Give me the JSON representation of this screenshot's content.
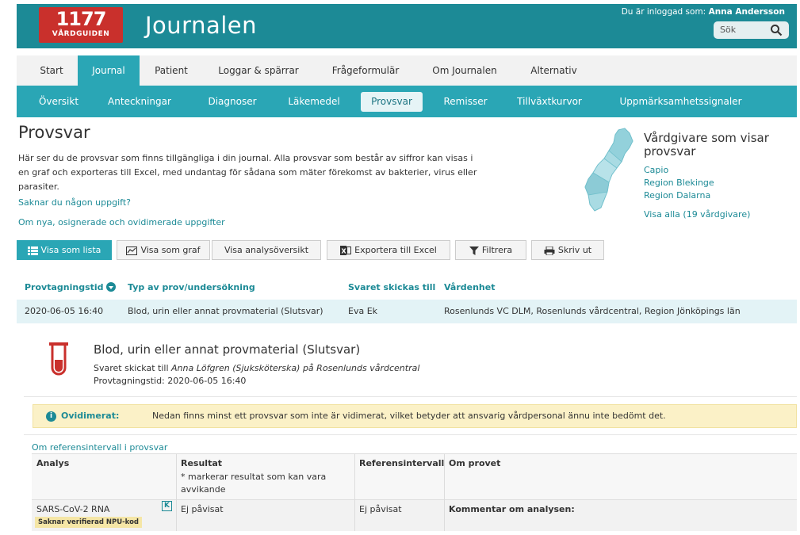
{
  "header": {
    "logo_number": "1177",
    "logo_brand": "VÅRDGUIDEN",
    "app_title": "Journalen",
    "login_prefix": "Du är inloggad som:",
    "login_user": "Anna Andersson",
    "search_placeholder": "Sök"
  },
  "main_nav": [
    {
      "label": "Start"
    },
    {
      "label": "Journal",
      "active": true
    },
    {
      "label": "Patient"
    },
    {
      "label": "Loggar & spärrar"
    },
    {
      "label": "Frågeformulär"
    },
    {
      "label": "Om Journalen"
    },
    {
      "label": "Alternativ"
    }
  ],
  "sub_nav": [
    {
      "label": "Översikt"
    },
    {
      "label": "Anteckningar"
    },
    {
      "label": "Diagnoser"
    },
    {
      "label": "Läkemedel"
    },
    {
      "label": "Provsvar",
      "active": true
    },
    {
      "label": "Remisser"
    },
    {
      "label": "Tillväxtkurvor"
    },
    {
      "label": "Uppmärksamhetssignaler"
    }
  ],
  "page": {
    "title": "Provsvar",
    "intro": "Här ser du de provsvar som finns tillgängliga i din journal. Alla provsvar som består av siffror kan visas i en graf och exporteras till Excel, med undantag för sådana som mäter förekomst av bakterier, virus eller parasiter.",
    "missing_link": "Saknar du någon uppgift?",
    "unsigned_link": "Om nya, osignerade och ovidimerade uppgifter"
  },
  "care_providers": {
    "title": "Vårdgivare som visar provsvar",
    "items": [
      "Capio",
      "Region Blekinge",
      "Region Dalarna"
    ],
    "show_all": "Visa alla (19 vårdgivare)"
  },
  "toolbar": {
    "list": "Visa som lista",
    "graph": "Visa som graf",
    "analysis": "Visa analysöversikt",
    "excel": "Exportera till Excel",
    "filter": "Filtrera",
    "print": "Skriv ut"
  },
  "results_table": {
    "headers": [
      "Provtagningstid",
      "Typ av prov/undersökning",
      "Svaret skickas till",
      "Vårdenhet"
    ],
    "rows": [
      [
        "2020-06-05 16:40",
        "Blod, urin eller annat provmaterial (Slutsvar)",
        "Eva Ek",
        "Rosenlunds VC DLM, Rosenlunds vårdcentral, Region Jönköpings län"
      ]
    ]
  },
  "detail": {
    "title": "Blod, urin eller annat provmaterial (Slutsvar)",
    "sent_prefix": "Svaret skickat till",
    "sent_person": "Anna Löfgren (Sjuksköterska)",
    "sent_mid": "på",
    "sent_unit": "Rosenlunds vårdcentral",
    "sample_time_label": "Provtagningstid:",
    "sample_time": "2020-06-05 16:40",
    "warning_icon": "i",
    "warning_label": "Ovidimerat:",
    "warning_text": "Nedan finns minst ett provsvar som inte är vidimerat, vilket betyder att ansvarig vårdpersonal ännu inte bedömt det.",
    "ref_link": "Om referensintervall i provsvar",
    "analysis_headers": {
      "analys": "Analys",
      "resultat": "Resultat",
      "resultat_note": "* markerar resultat som kan vara avvikande",
      "referens": "Referensintervall",
      "om_provet": "Om provet"
    },
    "analysis_rows": [
      {
        "analys": "SARS-CoV-2 RNA",
        "badge": "K",
        "tag": "Saknar verifierad NPU-kod",
        "resultat": "Ej påvisat",
        "referens": "Ej påvisat",
        "om_provet": "Kommentar om analysen:"
      }
    ]
  },
  "colors": {
    "header": "#1c8a96",
    "accent": "#2aa6b5",
    "logo": "#c9302c",
    "warning_bg": "#fbf1c7"
  }
}
